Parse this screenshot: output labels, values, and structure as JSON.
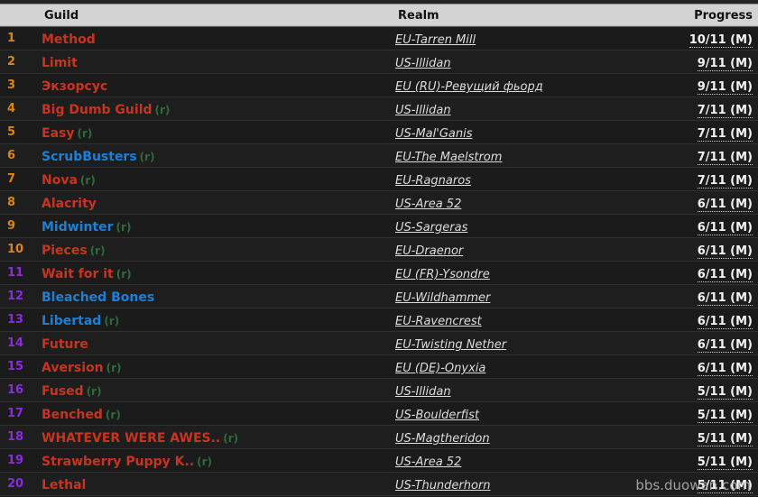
{
  "table": {
    "columns": {
      "rank": "",
      "guild": "Guild",
      "realm": "Realm",
      "progress": "Progress"
    },
    "colors": {
      "rank_gold": "#e08214",
      "rank_purple": "#8a2be2",
      "guild_horde": "#c8341f",
      "guild_alliance": "#1d7fd6",
      "recruiting_flag": "#2f6b3a",
      "header_bg": "#d3d3d3",
      "row_bg": "#1b1b1b"
    },
    "rows": [
      {
        "rank": "1",
        "rank_color": "gold",
        "guild": "Method",
        "faction": "horde",
        "recruiting": "",
        "realm": "EU-Tarren Mill",
        "progress": "10/11 (M)"
      },
      {
        "rank": "2",
        "rank_color": "gold",
        "guild": "Limit",
        "faction": "horde",
        "recruiting": "",
        "realm": "US-Illidan",
        "progress": "9/11 (M)"
      },
      {
        "rank": "3",
        "rank_color": "gold",
        "guild": "Экзорсус",
        "faction": "horde",
        "recruiting": "",
        "realm": "EU (RU)-Ревущий фьорд",
        "progress": "9/11 (M)"
      },
      {
        "rank": "4",
        "rank_color": "gold",
        "guild": "Big Dumb Guild",
        "faction": "horde",
        "recruiting": "(r)",
        "realm": "US-Illidan",
        "progress": "7/11 (M)"
      },
      {
        "rank": "5",
        "rank_color": "gold",
        "guild": "Easy",
        "faction": "horde",
        "recruiting": "(r)",
        "realm": "US-Mal'Ganis",
        "progress": "7/11 (M)"
      },
      {
        "rank": "6",
        "rank_color": "gold",
        "guild": "ScrubBusters",
        "faction": "alliance",
        "recruiting": "(r)",
        "realm": "EU-The Maelstrom",
        "progress": "7/11 (M)"
      },
      {
        "rank": "7",
        "rank_color": "gold",
        "guild": "Nova",
        "faction": "horde",
        "recruiting": "(r)",
        "realm": "EU-Ragnaros",
        "progress": "7/11 (M)"
      },
      {
        "rank": "8",
        "rank_color": "gold",
        "guild": "Alacrity",
        "faction": "horde",
        "recruiting": "",
        "realm": "US-Area 52",
        "progress": "6/11 (M)"
      },
      {
        "rank": "9",
        "rank_color": "gold",
        "guild": "Midwinter",
        "faction": "alliance",
        "recruiting": "(r)",
        "realm": "US-Sargeras",
        "progress": "6/11 (M)"
      },
      {
        "rank": "10",
        "rank_color": "gold",
        "guild": "Pieces",
        "faction": "horde",
        "recruiting": "(r)",
        "realm": "EU-Draenor",
        "progress": "6/11 (M)"
      },
      {
        "rank": "11",
        "rank_color": "purple",
        "guild": "Wait for it",
        "faction": "horde",
        "recruiting": "(r)",
        "realm": "EU (FR)-Ysondre",
        "progress": "6/11 (M)"
      },
      {
        "rank": "12",
        "rank_color": "purple",
        "guild": "Bleached Bones",
        "faction": "alliance",
        "recruiting": "",
        "realm": "EU-Wildhammer",
        "progress": "6/11 (M)"
      },
      {
        "rank": "13",
        "rank_color": "purple",
        "guild": "Libertad",
        "faction": "alliance",
        "recruiting": "(r)",
        "realm": "EU-Ravencrest",
        "progress": "6/11 (M)"
      },
      {
        "rank": "14",
        "rank_color": "purple",
        "guild": "Future",
        "faction": "horde",
        "recruiting": "",
        "realm": "EU-Twisting Nether",
        "progress": "6/11 (M)"
      },
      {
        "rank": "15",
        "rank_color": "purple",
        "guild": "Aversion",
        "faction": "horde",
        "recruiting": "(r)",
        "realm": "EU (DE)-Onyxia",
        "progress": "6/11 (M)"
      },
      {
        "rank": "16",
        "rank_color": "purple",
        "guild": "Fused",
        "faction": "horde",
        "recruiting": "(r)",
        "realm": "US-Illidan",
        "progress": "5/11 (M)"
      },
      {
        "rank": "17",
        "rank_color": "purple",
        "guild": "Benched",
        "faction": "horde",
        "recruiting": "(r)",
        "realm": "US-Boulderfist",
        "progress": "5/11 (M)"
      },
      {
        "rank": "18",
        "rank_color": "purple",
        "guild": "WHATEVER WERE AWES..",
        "faction": "horde",
        "recruiting": "(r)",
        "realm": "US-Magtheridon",
        "progress": "5/11 (M)"
      },
      {
        "rank": "19",
        "rank_color": "purple",
        "guild": "Strawberry Puppy K..",
        "faction": "horde",
        "recruiting": "(r)",
        "realm": "US-Area 52",
        "progress": "5/11 (M)"
      },
      {
        "rank": "20",
        "rank_color": "purple",
        "guild": "Lethal",
        "faction": "horde",
        "recruiting": "",
        "realm": "US-Thunderhorn",
        "progress": "5/11 (M)"
      }
    ]
  },
  "watermark": {
    "text": "bbs.duowan.com"
  }
}
